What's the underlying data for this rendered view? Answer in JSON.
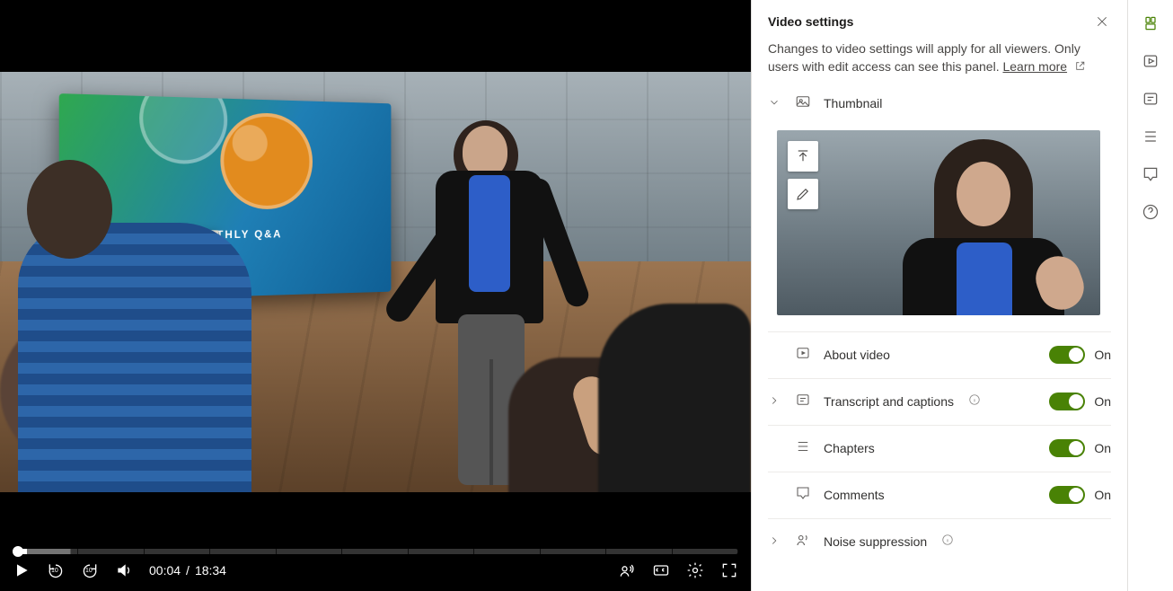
{
  "player": {
    "screen_wall_text": "CONTOSO MONTHLY Q&A",
    "current_time": "00:04",
    "time_separator": "/",
    "total_time": "18:34",
    "rewind_seconds": "10",
    "forward_seconds": "10"
  },
  "panel": {
    "title": "Video settings",
    "description_prefix": "Changes to video settings will apply for all viewers. Only users with edit access can see this panel. ",
    "learn_more": "Learn more",
    "sections": {
      "thumbnail": {
        "label": "Thumbnail"
      },
      "about": {
        "label": "About video",
        "state": "On"
      },
      "transcript": {
        "label": "Transcript and captions",
        "state": "On"
      },
      "chapters": {
        "label": "Chapters",
        "state": "On"
      },
      "comments": {
        "label": "Comments",
        "state": "On"
      },
      "noise": {
        "label": "Noise suppression"
      }
    }
  },
  "rail": {
    "items": [
      "settings-icon",
      "play-icon",
      "transcript-icon",
      "chapters-icon",
      "comments-icon",
      "help-icon"
    ]
  }
}
